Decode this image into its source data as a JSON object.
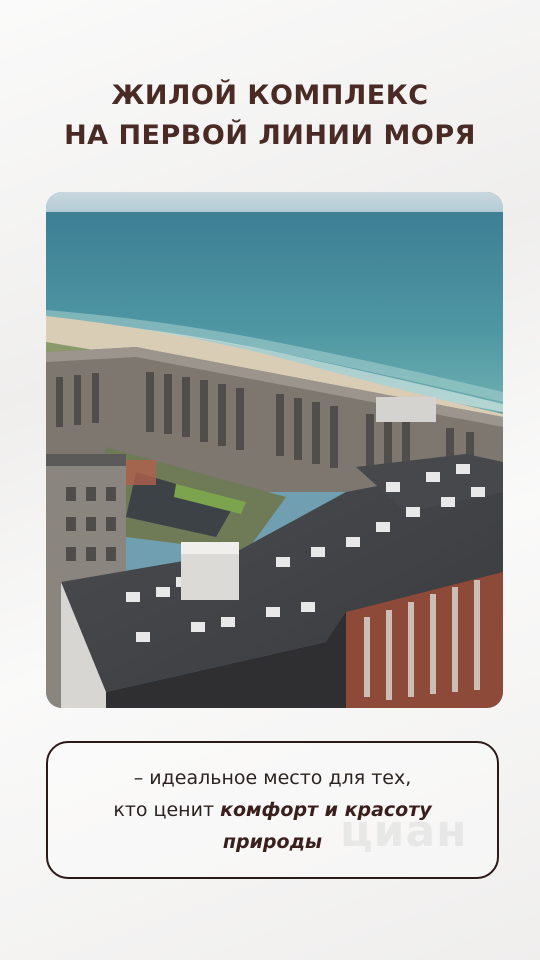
{
  "title": {
    "line1": "ЖИЛОЙ КОМПЛЕКС",
    "line2": "НА ПЕРВОЙ ЛИНИИ МОРЯ"
  },
  "photo": {
    "subject": "aerial-view-residential-complex-by-sea"
  },
  "caption": {
    "line1": "– идеальное место для тех,",
    "line2_plain": "кто ценит ",
    "line2_emphasis": "комфорт и красоту",
    "line3_emphasis": "природы"
  },
  "watermark": "циан",
  "colors": {
    "title": "#4a2a24",
    "background": "#f3f2f1",
    "border": "#2a1a18"
  }
}
